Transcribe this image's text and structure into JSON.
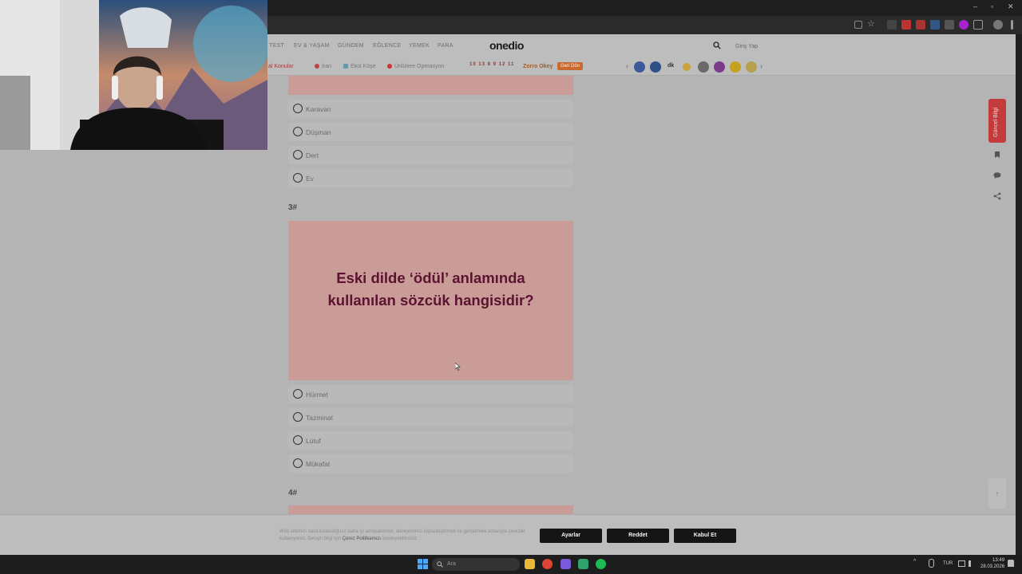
{
  "browser": {
    "window_controls": [
      "–",
      "▫",
      "✕"
    ]
  },
  "site": {
    "logo": "onedio",
    "nav": [
      "TEST",
      "EV & YAŞAM",
      "GÜNDEM",
      "EĞLENCE",
      "YEMEK",
      "PARA"
    ],
    "login": "Giriş Yap",
    "subnav": [
      "al Konular",
      "İran",
      "Ekol Köşe",
      "Ünlülere Operasyon"
    ],
    "dates": "10 13 8 9 12 11",
    "zorro": "Zorro Okey",
    "geri_sec": "Geri Dön",
    "badge_text": "dk"
  },
  "quiz": {
    "prev_options": [
      "Karavan",
      "Düşman",
      "Dert",
      "Ev"
    ],
    "q3_number": "3#",
    "q3_text": "Eski dilde ‘ödül’ anlamında kullanılan sözcük hangisidir?",
    "q3_options": [
      "Hürmet",
      "Tazminat",
      "Lütuf",
      "Mükafat"
    ],
    "q4_number": "4#"
  },
  "side": {
    "follow": "Güncel Bilgi",
    "scroll_top": "↑"
  },
  "cookie": {
    "text_start": "Web sitemizi nasıl kullandığınız daha iyi anlayabilmek, deneyiminizi kişiselleştirmek ve geliştirmek amacıyla çerezler kullanıyoruz. Detaylı bilgi için ",
    "link": "Çerez Politikamızı",
    "text_end": " inceleyebilirsiniz.",
    "settings": "Ayarlar",
    "reject": "Reddet",
    "accept": "Kabul Et"
  },
  "taskbar": {
    "search": "Ara",
    "lang": "TUR",
    "time": "13:49",
    "date": "28.03.2026"
  },
  "colors": {
    "card": "#c99c98",
    "question": "#5c1230",
    "accent_red": "#c43b3b"
  }
}
